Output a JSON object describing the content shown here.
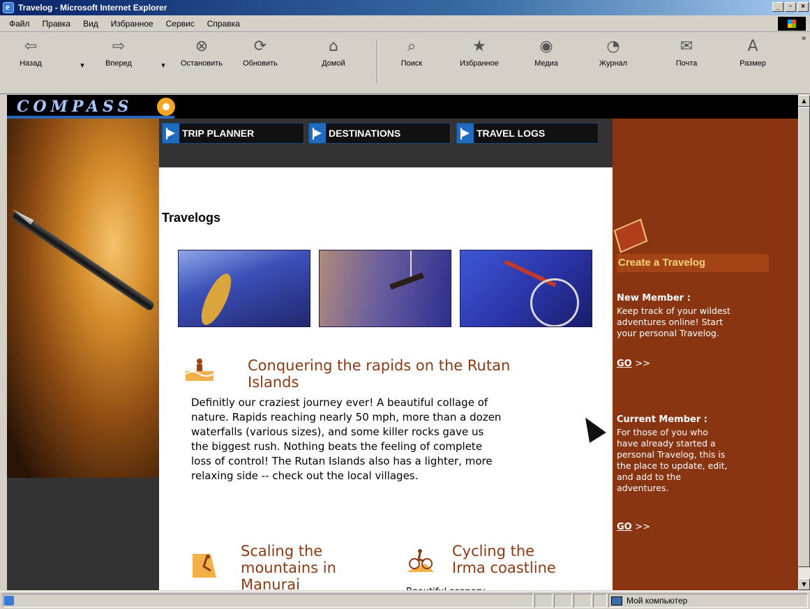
{
  "window": {
    "title": "Travelog - Microsoft Internet Explorer",
    "buttons": [
      "_",
      "▫",
      "×"
    ]
  },
  "menu": [
    "Файл",
    "Правка",
    "Вид",
    "Избранное",
    "Сервис",
    "Справка"
  ],
  "toolbar": {
    "back": "Назад",
    "forward": "Вперед",
    "stop": "Остановить",
    "refresh": "Обновить",
    "home": "Домой",
    "search": "Поиск",
    "favorites": "Избранное",
    "media": "Медиа",
    "history": "Журнал",
    "mail": "Почта",
    "size": "Размер",
    "more": "»"
  },
  "site": {
    "brand": "COMPASS",
    "nav": [
      "TRIP PLANNER",
      "DESTINATIONS",
      "TRAVEL LOGS"
    ]
  },
  "main": {
    "title": "Travelogs",
    "featured": {
      "title_line1": "Conquering the rapids on the Rutan",
      "title_line2": "Islands",
      "body": [
        "Definitly our craziest journey ever! A beautiful collage of",
        "nature. Rapids reaching nearly 50 mph, more than a dozen",
        "waterfalls (various sizes), and some killer rocks gave us",
        "the biggest rush. Nothing beats the feeling of complete",
        "loss of control! The Rutan Islands also has a lighter, more",
        "relaxing side -- check out the local villages."
      ]
    },
    "article2": {
      "line1": "Scaling the",
      "line2": "mountains in",
      "line3": "Manurai"
    },
    "article3": {
      "line1": "Cycling the",
      "line2": "Irma coastline",
      "snippet": "Beautiful scenery"
    }
  },
  "sidebar": {
    "create": "Create a Travelog",
    "new_head": "New Member :",
    "new_text": [
      "Keep track of your wildest",
      "adventures online! Start",
      "your personal Travelog."
    ],
    "current_head": "Current Member :",
    "current_text": [
      "For those of you who",
      "have already started a",
      "personal Travelog, this is",
      "the place to update, edit,",
      "and add to the",
      "adventures."
    ],
    "go": "GO",
    "arrows": ">>"
  },
  "status": {
    "zone": "Мой компьютер"
  },
  "colors": {
    "sidebar_bg": "#8a3512",
    "article_title": "#8b3a12",
    "nav_bg": "#333333"
  }
}
